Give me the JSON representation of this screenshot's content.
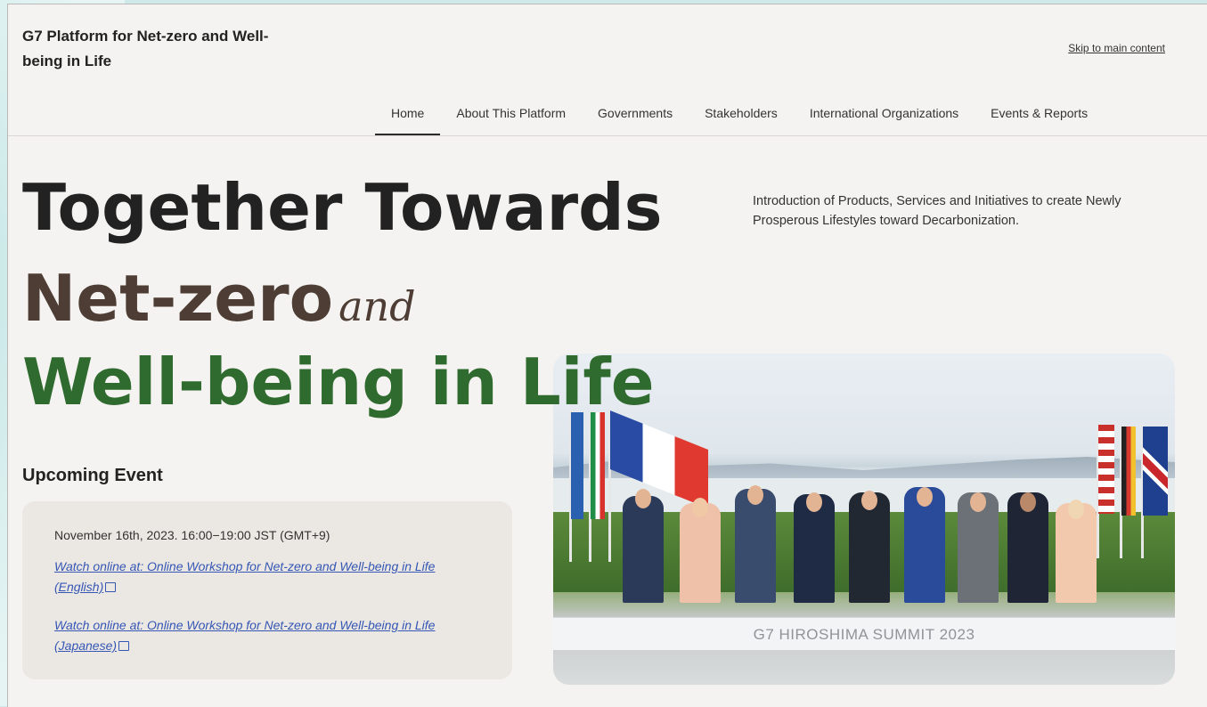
{
  "site": {
    "title": "G7 Platform for Net-zero and Well-being in Life",
    "skip_link": "Skip to main content"
  },
  "nav": {
    "items": [
      {
        "label": "Home",
        "active": true
      },
      {
        "label": "About This Platform",
        "active": false
      },
      {
        "label": "Governments",
        "active": false
      },
      {
        "label": "Stakeholders",
        "active": false
      },
      {
        "label": "International Organizations",
        "active": false
      },
      {
        "label": "Events & Reports",
        "active": false
      }
    ]
  },
  "hero": {
    "line1": "Together Towards",
    "line2_main": "Net-zero",
    "line2_connector": "and",
    "line3": "Well-being in Life",
    "intro": "Introduction of Products, Services and Initiatives to create Newly Prosperous Lifestyles toward Decarbonization."
  },
  "upcoming": {
    "heading": "Upcoming Event",
    "date": "November 16th, 2023. 16:00−19:00 JST (GMT+9)",
    "links": [
      {
        "text": "Watch online at: Online Workshop for Net-zero and Well-being in Life (English)",
        "icon": "external-link-icon"
      },
      {
        "text": "Watch online at: Online Workshop for Net-zero and Well-being in Life (Japanese)",
        "icon": "external-link-icon"
      }
    ]
  },
  "photo": {
    "stage_text": "G7 HIROSHIMA SUMMIT 2023"
  },
  "colors": {
    "hero_dark": "#222222",
    "hero_brown": "#4d3d34",
    "hero_green": "#2f6a2e",
    "link": "#3556b5",
    "card_bg": "#ebe8e3"
  }
}
